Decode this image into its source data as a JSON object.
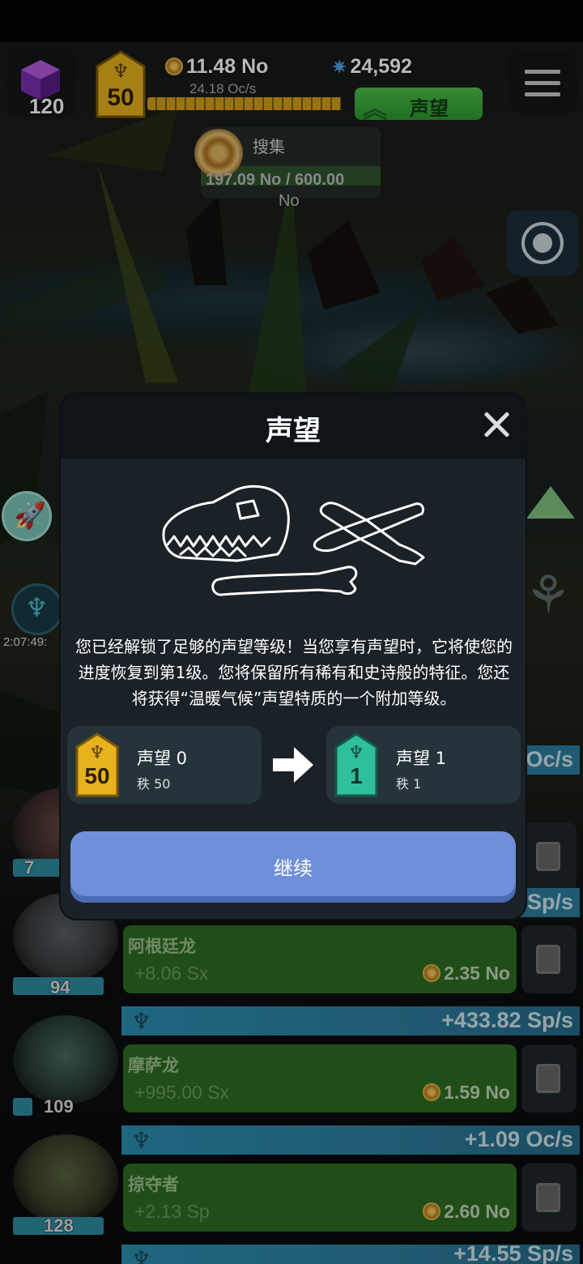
{
  "hud": {
    "cube_count": "120",
    "level": "50",
    "currency_main": "11.48 No",
    "currency_rate": "24.18 Oc/s",
    "stars": "24,592",
    "prestige_button": "声望",
    "xp_progress": 0.92
  },
  "collect": {
    "title": "搜集",
    "value": "197.09 No / 600.00",
    "unit": "No"
  },
  "timer": "2:07:49:",
  "modal": {
    "title": "声望",
    "description": "您已经解锁了足够的声望等级！当您享有声望时，它将使您的进度恢复到第1级。您将保留所有稀有和史诗般的特征。您还将获得“温暖气候”声望特质的一个附加等级。",
    "current": {
      "name": "声望 0",
      "sub": "秩 50",
      "badge": "50"
    },
    "next": {
      "name": "声望 1",
      "sub": "秩 1",
      "badge": "1"
    },
    "continue": "继续"
  },
  "list": {
    "partial_rate_top": "Oc/s",
    "partial_rate_2": "Sp/s",
    "rows": [
      {
        "count": "94",
        "name": "阿根廷龙",
        "gain": "+8.06 Sx",
        "cost": "2.35 No",
        "rate": "+433.82 Sp/s"
      },
      {
        "count": "109",
        "name": "摩萨龙",
        "gain": "+995.00 Sx",
        "cost": "1.59 No",
        "rate": "+1.09 Oc/s"
      },
      {
        "count": "128",
        "name": "掠夺者",
        "gain": "+2.13 Sp",
        "cost": "2.60 No",
        "rate": "+14.55 Sp/s"
      }
    ],
    "row0_count": "7"
  },
  "colors": {
    "prestige_green": "#3aae3a",
    "gold_badge": "#e8b21e",
    "teal_badge": "#2fbf9a",
    "continue_blue": "#6f8fd8"
  }
}
